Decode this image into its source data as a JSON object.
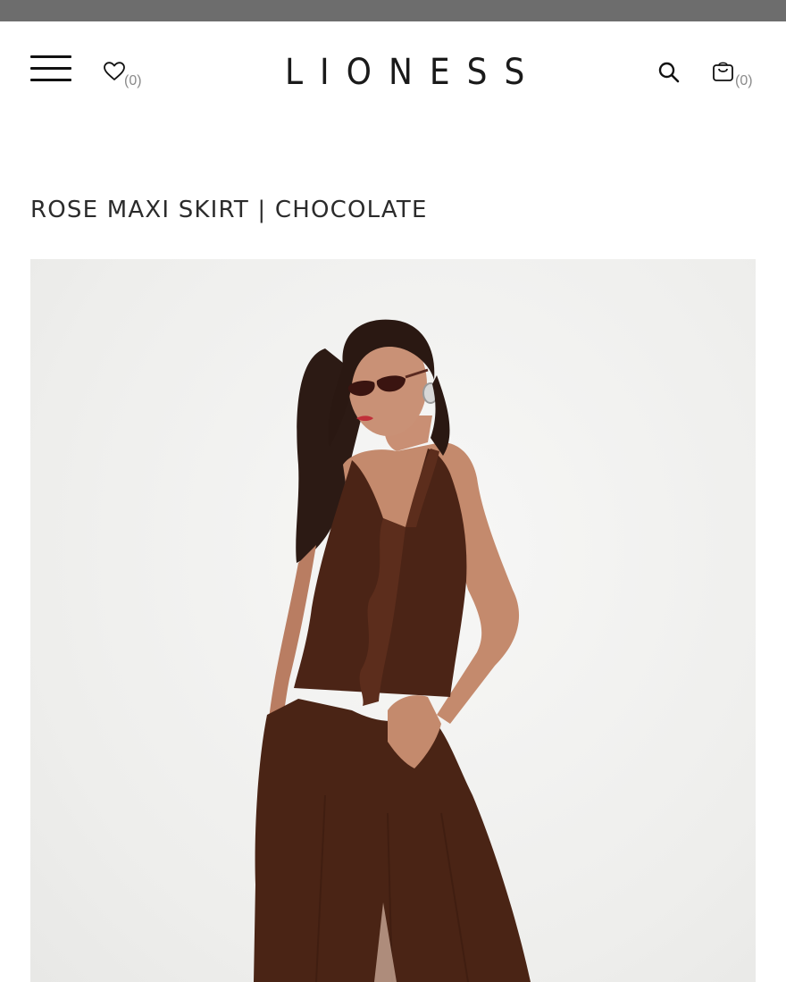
{
  "header": {
    "brand": "LIONESS",
    "wishlist": {
      "icon": "heart-icon",
      "count": "(0)"
    },
    "search": {
      "icon": "search-icon"
    },
    "cart": {
      "icon": "shopping-bag-icon",
      "count": "(0)"
    },
    "menu": {
      "icon": "hamburger-menu-icon"
    }
  },
  "product": {
    "title": "ROSE MAXI SKIRT | CHOCOLATE",
    "image": {
      "icon": "product-photo-model-brown-outfit"
    }
  },
  "colors": {
    "announcement_bar": "#6d6d6d",
    "product_brown": "#4a2516",
    "text": "#1a1a1a"
  }
}
